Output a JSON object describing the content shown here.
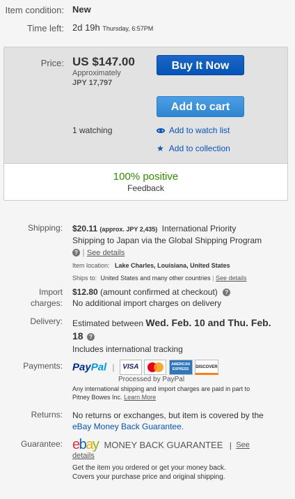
{
  "condition": {
    "label": "Item condition:",
    "value": "New"
  },
  "time_left": {
    "label": "Time left:",
    "value": "2d 19h",
    "end": "Thursday, 6:57PM"
  },
  "price": {
    "label": "Price:",
    "value": "US $147.00",
    "approx_label": "Approximately",
    "approx_value": "JPY 17,797",
    "buy_now": "Buy It Now",
    "add_to_cart": "Add to cart",
    "watching": "1 watching",
    "add_watch": "Add to watch list",
    "add_collection": "Add to collection",
    "feedback_pct": "100% positive",
    "feedback_label": "Feedback"
  },
  "shipping": {
    "label": "Shipping:",
    "cost": "$20.11",
    "approx": "(approx. JPY 2,435)",
    "desc_line1": "International Priority",
    "desc_line2": "Shipping to Japan  via the Global Shipping Program",
    "see_details": "See details",
    "item_location_label": "Item location:",
    "item_location": "Lake Charles, Louisiana, United States",
    "ships_to_label": "Ships to:",
    "ships_to": "United States and many other countries",
    "ships_to_details": "See details"
  },
  "import": {
    "label_line1": "Import",
    "label_line2": "charges:",
    "cost": "$12.80",
    "cost_note": "(amount confirmed at checkout)",
    "note": "No additional import charges on delivery"
  },
  "delivery": {
    "label": "Delivery:",
    "prefix": "Estimated between",
    "dates_line1": "Wed. Feb. 10 and Thu. Feb.",
    "dates_line2": "18",
    "tracking": "Includes international tracking"
  },
  "payments": {
    "label": "Payments:",
    "paypal_a": "Pay",
    "paypal_b": "Pal",
    "processed": "Processed by PayPal",
    "visa": "VISA",
    "amex": "AMERICAN EXPRESS",
    "discover": "DISCOVER",
    "note_line1": "Any international shipping and import charges are paid in part to",
    "note_line2": "Pitney Bowes Inc.",
    "learn_more": "Learn More"
  },
  "returns": {
    "label": "Returns:",
    "line1": "No returns or exchanges, but item is covered by the",
    "line2": "eBay Money Back Guarantee."
  },
  "guarantee": {
    "label": "Guarantee:",
    "e": "e",
    "b": "b",
    "a": "a",
    "y": "y",
    "mbg": "MONEY BACK GUARANTEE",
    "see": "See",
    "details": "details",
    "line1": "Get the item you ordered or get your money back.",
    "line2": "Covers your purchase price and original shipping."
  },
  "colors": {
    "brand_blue": "#0654ba",
    "positive_green": "#2f8e00",
    "ebay_red": "#e53238",
    "ebay_blue": "#0064d2",
    "ebay_yellow": "#f5af02",
    "ebay_green": "#86b817"
  }
}
